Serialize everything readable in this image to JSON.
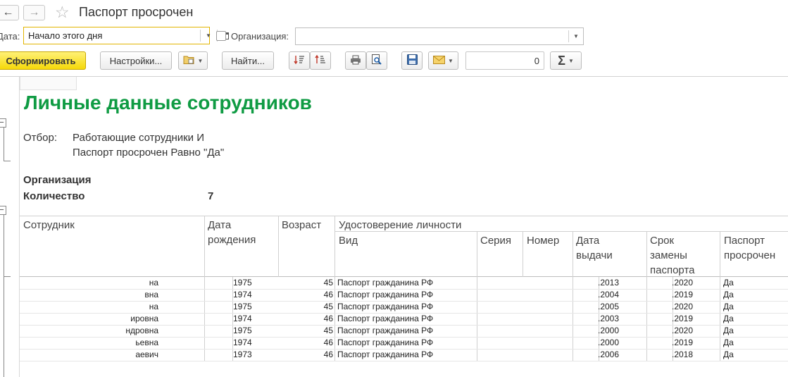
{
  "window": {
    "title": "Паспорт просрочен",
    "back_icon": "arrow-left-icon",
    "forward_icon": "arrow-right-icon",
    "favorite_icon": "star-icon"
  },
  "filters": {
    "date_label": "Дата:",
    "date_value": "Начало этого дня",
    "org_label": "Организация:",
    "org_value": ""
  },
  "toolbar": {
    "generate_label": "Сформировать",
    "settings_label": "Настройки...",
    "find_label": "Найти...",
    "number_value": "0"
  },
  "report": {
    "title": "Личные данные сотрудников",
    "filter_label": "Отбор:",
    "filter_lines": [
      "Работающие сотрудники И",
      "Паспорт просрочен Равно \"Да\""
    ],
    "org_group_label": "Организация",
    "count_label": "Количество",
    "count_value": "7",
    "title_color": "#0f9b43"
  },
  "table": {
    "headers": {
      "employee": "Сотрудник",
      "birth_date": "Дата рождения",
      "age": "Возраст",
      "identity": "Удостоверение личности",
      "kind": "Вид",
      "series": "Серия",
      "number": "Номер",
      "issue_date": "Дата выдачи",
      "replace_date": "Срок замены паспорта",
      "expired": "Паспорт просрочен"
    },
    "rows": [
      {
        "employee": "на",
        "birth": "1975",
        "age": "45",
        "kind": "Паспорт гражданина РФ",
        "issued": ".2013",
        "replace": ".2020",
        "expired": "Да"
      },
      {
        "employee": "вна",
        "birth": "1974",
        "age": "46",
        "kind": "Паспорт гражданина РФ",
        "issued": ".2004",
        "replace": ".2019",
        "expired": "Да"
      },
      {
        "employee": "на",
        "birth": "1975",
        "age": "45",
        "kind": "Паспорт гражданина РФ",
        "issued": ".2005",
        "replace": ".2020",
        "expired": "Да"
      },
      {
        "employee": "ировна",
        "birth": "1974",
        "age": "46",
        "kind": "Паспорт гражданина РФ",
        "issued": ".2003",
        "replace": ".2019",
        "expired": "Да"
      },
      {
        "employee": "ндровна",
        "birth": "1975",
        "age": "45",
        "kind": "Паспорт гражданина РФ",
        "issued": ".2000",
        "replace": ".2020",
        "expired": "Да"
      },
      {
        "employee": "ьевна",
        "birth": "1974",
        "age": "46",
        "kind": "Паспорт гражданина РФ",
        "issued": ".2000",
        "replace": ".2019",
        "expired": "Да"
      },
      {
        "employee": "аевич",
        "birth": "1973",
        "age": "46",
        "kind": "Паспорт гражданина РФ",
        "issued": ".2006",
        "replace": ".2018",
        "expired": "Да"
      }
    ]
  }
}
